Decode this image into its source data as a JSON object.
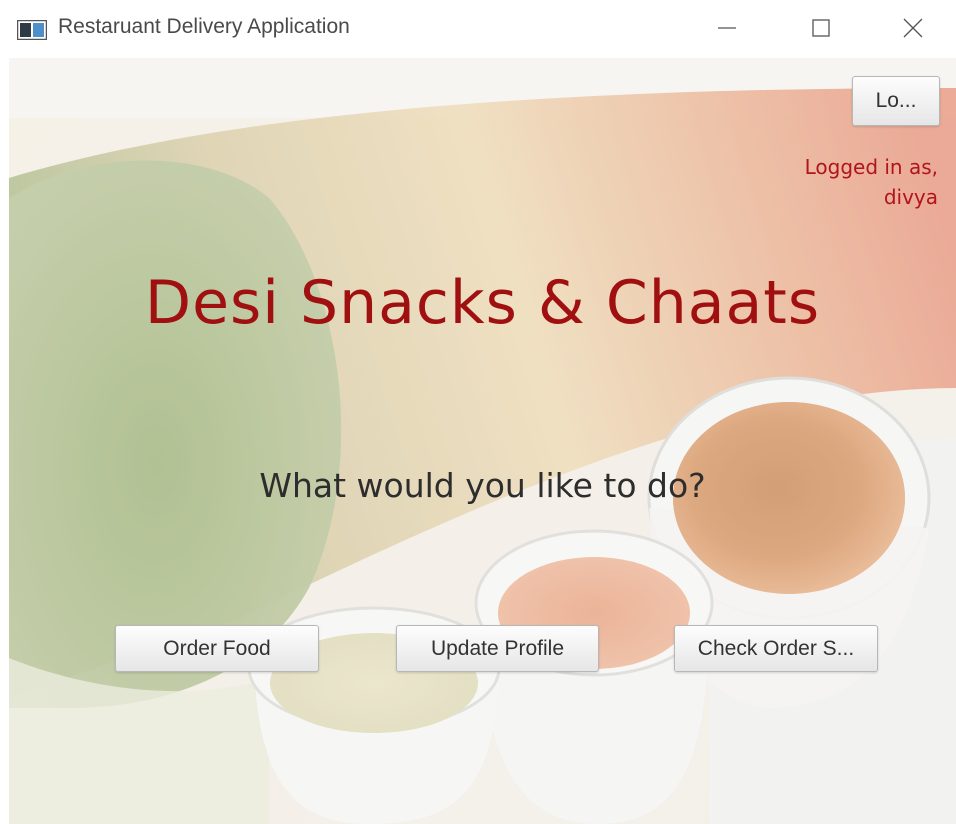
{
  "window": {
    "title": "Restaruant Delivery Application"
  },
  "icons": {
    "app": "app-window-icon",
    "minimize": "minimize-icon",
    "maximize": "maximize-icon",
    "close": "close-icon"
  },
  "header": {
    "logout_label": "Lo...",
    "logged_in_line1": "Logged in as,",
    "logged_in_user": "divya"
  },
  "main": {
    "title": "Desi Snacks & Chaats",
    "prompt": "What would you like to do?"
  },
  "actions": {
    "order_label": "Order Food",
    "update_label": "Update Profile",
    "status_label": "Check Order S..."
  },
  "colors": {
    "title_red": "#a01010",
    "logged_red": "#b0141c"
  }
}
